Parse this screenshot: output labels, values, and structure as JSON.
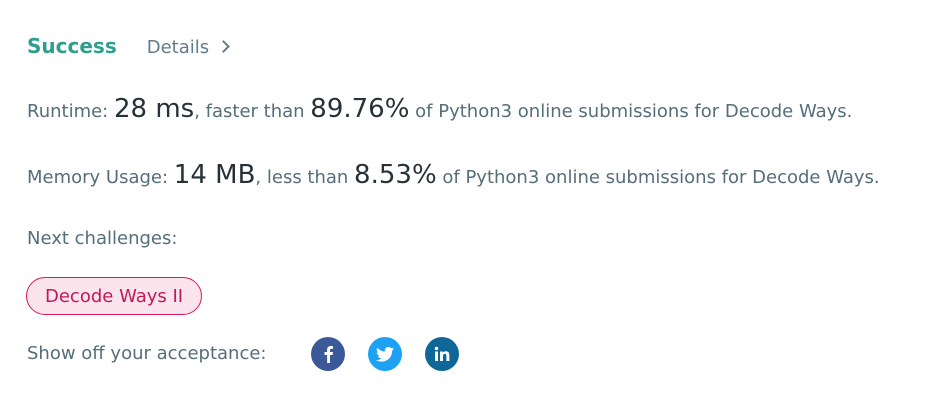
{
  "header": {
    "status": "Success",
    "details_label": "Details"
  },
  "runtime": {
    "label": "Runtime: ",
    "value": "28 ms",
    "mid": ", faster than ",
    "percent": "89.76%",
    "suffix": " of Python3 online submissions for Decode Ways."
  },
  "memory": {
    "label": "Memory Usage: ",
    "value": "14 MB",
    "mid": ", less than ",
    "percent": "8.53%",
    "suffix": " of Python3 online submissions for Decode Ways."
  },
  "next": {
    "label": "Next challenges:",
    "challenges": [
      "Decode Ways II"
    ]
  },
  "share": {
    "label": "Show off your acceptance:",
    "icons": [
      "facebook-icon",
      "twitter-icon",
      "linkedin-icon"
    ]
  },
  "colors": {
    "success": "#2e9f8e",
    "pill_border": "#d81b60",
    "pill_bg": "#fce4ec",
    "facebook": "#3b5998",
    "twitter": "#1da1f2",
    "linkedin": "#0e6796"
  }
}
